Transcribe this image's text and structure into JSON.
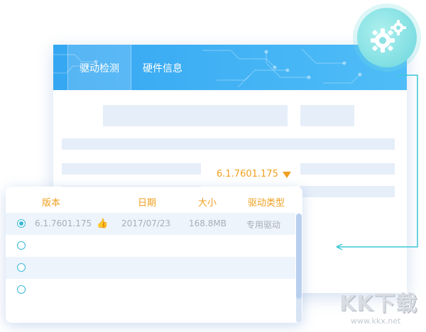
{
  "window": {
    "tabs": [
      {
        "label": "驱动检测",
        "active": true
      },
      {
        "label": "硬件信息",
        "active": false
      }
    ],
    "header_color": "#35a7f2",
    "selected_version": "6.1.7601.175"
  },
  "driver_table": {
    "columns": [
      "版本",
      "日期",
      "大小",
      "驱动类型"
    ],
    "rows": [
      {
        "selected": true,
        "version": "6.1.7601.175",
        "recommended_icon": "thumbs-up-icon",
        "date": "2017/07/23",
        "size": "168.8MB",
        "type": "专用驱动"
      },
      {
        "selected": false,
        "version": "",
        "date": "",
        "size": "",
        "type": ""
      },
      {
        "selected": false,
        "version": "",
        "date": "",
        "size": "",
        "type": ""
      },
      {
        "selected": false,
        "version": "",
        "date": "",
        "size": "",
        "type": ""
      }
    ]
  },
  "badge": {
    "icon": "gears-icon"
  },
  "watermark": {
    "logo": "KK下载",
    "url": "www.kkx.net"
  },
  "colors": {
    "accent": "#f0a020",
    "radio": "#39b7d8",
    "teal": "#6ad6dd"
  }
}
